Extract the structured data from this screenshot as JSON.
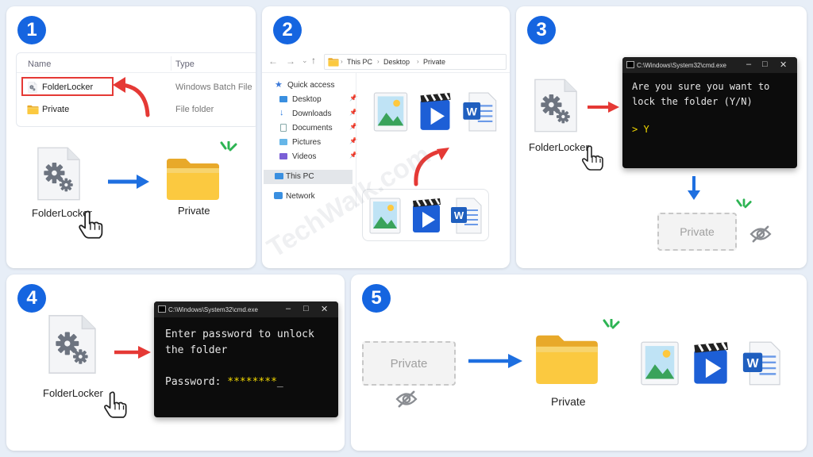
{
  "steps": [
    "1",
    "2",
    "3",
    "4",
    "5"
  ],
  "watermark": "TechWalk.com",
  "panel1": {
    "col_name": "Name",
    "col_type": "Type",
    "files": [
      {
        "name": "FolderLocker",
        "type": "Windows Batch File"
      },
      {
        "name": "Private",
        "type": "File folder"
      }
    ],
    "bat_label": "FolderLocker",
    "folder_label": "Private"
  },
  "panel2": {
    "path": [
      "This PC",
      "Desktop",
      "Private"
    ],
    "nav": [
      {
        "label": "Quick access",
        "pinned": false
      },
      {
        "label": "Desktop",
        "pinned": true
      },
      {
        "label": "Downloads",
        "pinned": true
      },
      {
        "label": "Documents",
        "pinned": true
      },
      {
        "label": "Pictures",
        "pinned": true
      },
      {
        "label": "Videos",
        "pinned": true
      },
      {
        "label": "This PC",
        "pinned": false
      },
      {
        "label": "Network",
        "pinned": false
      }
    ]
  },
  "panel3": {
    "cmd_title": "C:\\Windows\\System32\\cmd.exe",
    "prompt_line1": "Are you sure you want to",
    "prompt_line2": "lock the folder (Y/N)",
    "answer": "> Y",
    "bat_label": "FolderLocker",
    "hidden_label": "Private"
  },
  "panel4": {
    "cmd_title": "C:\\Windows\\System32\\cmd.exe",
    "line1": "Enter password to unlock",
    "line2": "the folder",
    "password_label": "Password: ",
    "password_mask": "********",
    "cursor": "_",
    "bat_label": "FolderLocker"
  },
  "panel5": {
    "hidden_label": "Private",
    "folder_label": "Private"
  },
  "colors": {
    "accent": "#1565e0",
    "arrow_red": "#e53935",
    "arrow_blue": "#1e6fe0",
    "cmd_yellow": "#f2d800"
  }
}
